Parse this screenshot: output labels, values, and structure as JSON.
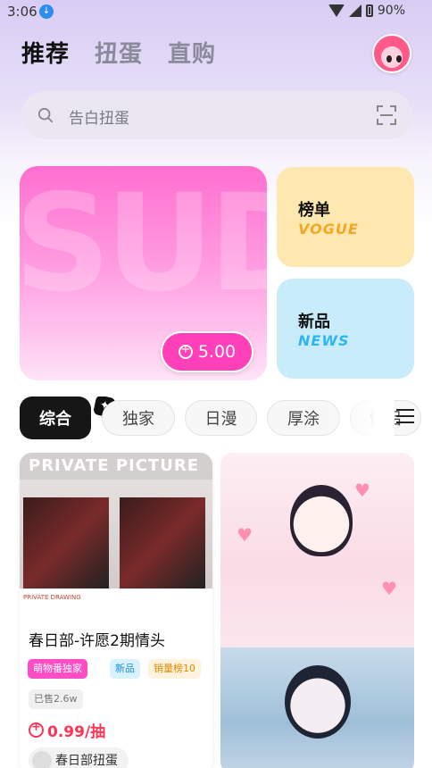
{
  "status_bar": {
    "time": "3:06",
    "battery": "90%"
  },
  "header": {
    "tabs": [
      "推荐",
      "扭蛋",
      "直购"
    ],
    "active_tab": 0
  },
  "search": {
    "placeholder": "告白扭蛋"
  },
  "banner": {
    "price": "5.00",
    "cards": [
      {
        "title": "榜单",
        "subtitle": "VOGUE"
      },
      {
        "title": "新品",
        "subtitle": "NEWS"
      }
    ]
  },
  "categories": [
    "综合",
    "独家",
    "日漫",
    "厚涂",
    "情侣"
  ],
  "products": [
    {
      "image_header": "PRIVATE PICTURE",
      "image_footer": "PRIVATE DRAWING",
      "title": "春日部-许愿2期情头",
      "tags": [
        "萌物番独家",
        "新品",
        "销量榜10"
      ],
      "sold": "已售2.6w",
      "price": "0.99/抽",
      "shop": "春日部扭蛋"
    }
  ],
  "colors": {
    "accent_pink": "#ff40b8",
    "price_red": "#ff3355",
    "rank_bg": "#ffe8b0",
    "new_bg": "#c9ecfa"
  }
}
